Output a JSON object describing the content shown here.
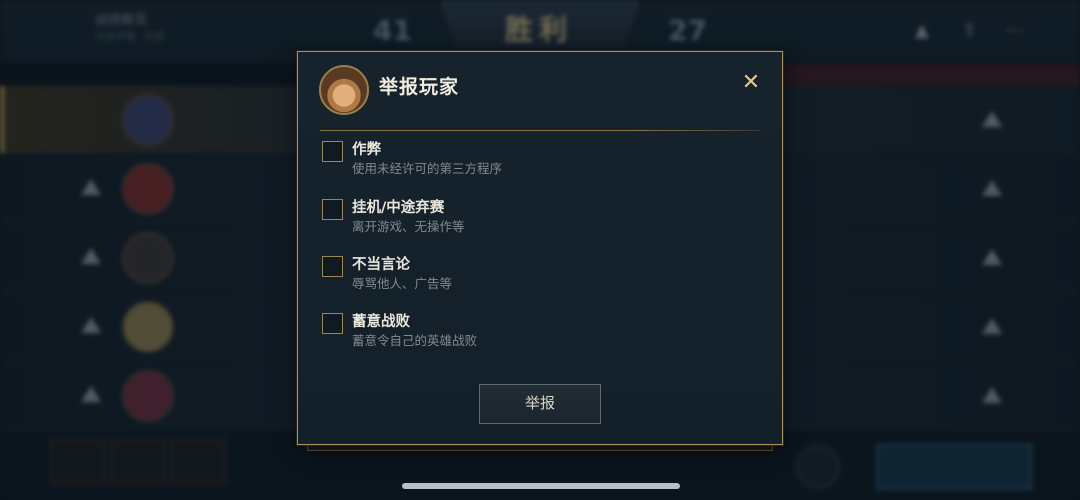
{
  "background": {
    "result_banner": "胜利",
    "score_left": "41",
    "score_right": "27",
    "player_name": "战绩概览",
    "player_sub": "分段详情 · 玩家",
    "top_icons": [
      "warning-icon",
      "share-icon",
      "more-icon"
    ]
  },
  "dialog": {
    "title": "举报玩家",
    "close_symbol": "✕",
    "options": [
      {
        "label": "作弊",
        "desc": "使用未经许可的第三方程序"
      },
      {
        "label": "挂机/中途弃赛",
        "desc": "离开游戏、无操作等"
      },
      {
        "label": "不当言论",
        "desc": "辱骂他人、广告等"
      },
      {
        "label": "蓄意战败",
        "desc": "蓄意令自己的英雄战败"
      }
    ],
    "submit_label": "举报"
  },
  "colors": {
    "accent_gold": "#a8925a",
    "dialog_bg": "#16232d",
    "label_text": "#e9e6dc",
    "desc_text": "#7f8a92"
  }
}
